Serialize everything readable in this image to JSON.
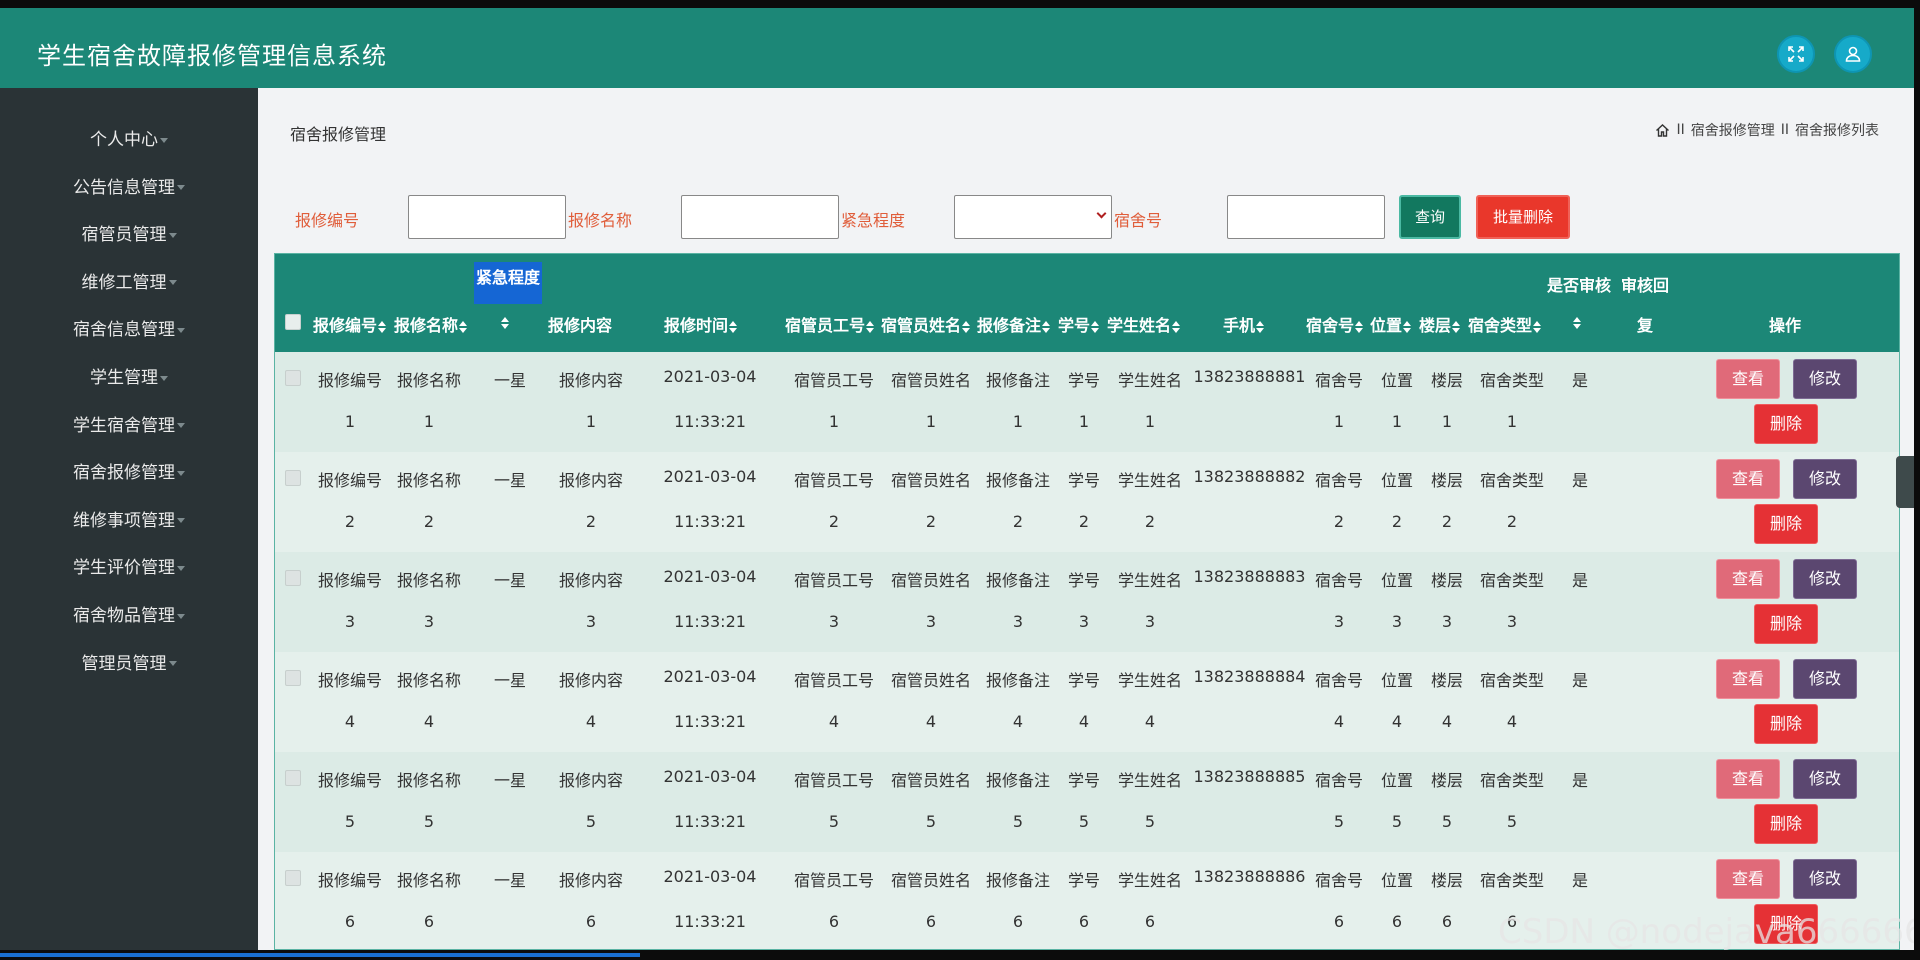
{
  "app": {
    "title": "学生宿舍故障报修管理信息系统"
  },
  "sidebar": {
    "items": [
      {
        "label": "个人中心"
      },
      {
        "label": "公告信息管理"
      },
      {
        "label": "宿管员管理"
      },
      {
        "label": "维修工管理"
      },
      {
        "label": "宿舍信息管理"
      },
      {
        "label": "学生管理"
      },
      {
        "label": "学生宿舍管理"
      },
      {
        "label": "宿舍报修管理"
      },
      {
        "label": "维修事项管理"
      },
      {
        "label": "学生评价管理"
      },
      {
        "label": "宿舍物品管理"
      },
      {
        "label": "管理员管理"
      }
    ]
  },
  "page": {
    "title": "宿舍报修管理",
    "breadcrumb": [
      "宿舍报修管理",
      "宿舍报修列表"
    ],
    "breadcrumb_sep": "II"
  },
  "filters": {
    "code_label": "报修编号",
    "name_label": "报修名称",
    "urgency_label": "紧急程度",
    "room_label": "宿舍号",
    "query_button": "查询",
    "batch_delete_button": "批量删除"
  },
  "table": {
    "header_top": {
      "urgency": "紧急程度",
      "approved": "是否审核",
      "reply": "审核回"
    },
    "headers": {
      "code": "报修编号",
      "name": "报修名称",
      "content": "报修内容",
      "time": "报修时间",
      "staff_no": "宿管员工号",
      "staff_name": "宿管员姓名",
      "note": "报修备注",
      "student_no": "学号",
      "student_name": "学生姓名",
      "phone": "手机",
      "room": "宿舍号",
      "location": "位置",
      "floor": "楼层",
      "room_type": "宿舍类型",
      "reply": "复",
      "actions": "操作"
    },
    "rows": [
      {
        "code": "报修编号",
        "code2": "1",
        "name": "报修名称",
        "name2": "1",
        "urgency": "一星",
        "content": "报修内容",
        "content2": "1",
        "date": "2021-03-04",
        "time": "11:33:21",
        "staff_no": "宿管员工号",
        "staff_no2": "1",
        "staff_name": "宿管员姓名",
        "staff_name2": "1",
        "note": "报修备注",
        "note2": "1",
        "student_no": "学号",
        "student_no2": "1",
        "student_name": "学生姓名",
        "student_name2": "1",
        "phone": "13823888881",
        "room": "宿舍号",
        "room2": "1",
        "location": "位置",
        "location2": "1",
        "floor": "楼层",
        "floor2": "1",
        "room_type": "宿舍类型",
        "room_type2": "1",
        "approved": "是"
      },
      {
        "code": "报修编号",
        "code2": "2",
        "name": "报修名称",
        "name2": "2",
        "urgency": "一星",
        "content": "报修内容",
        "content2": "2",
        "date": "2021-03-04",
        "time": "11:33:21",
        "staff_no": "宿管员工号",
        "staff_no2": "2",
        "staff_name": "宿管员姓名",
        "staff_name2": "2",
        "note": "报修备注",
        "note2": "2",
        "student_no": "学号",
        "student_no2": "2",
        "student_name": "学生姓名",
        "student_name2": "2",
        "phone": "13823888882",
        "room": "宿舍号",
        "room2": "2",
        "location": "位置",
        "location2": "2",
        "floor": "楼层",
        "floor2": "2",
        "room_type": "宿舍类型",
        "room_type2": "2",
        "approved": "是"
      },
      {
        "code": "报修编号",
        "code2": "3",
        "name": "报修名称",
        "name2": "3",
        "urgency": "一星",
        "content": "报修内容",
        "content2": "3",
        "date": "2021-03-04",
        "time": "11:33:21",
        "staff_no": "宿管员工号",
        "staff_no2": "3",
        "staff_name": "宿管员姓名",
        "staff_name2": "3",
        "note": "报修备注",
        "note2": "3",
        "student_no": "学号",
        "student_no2": "3",
        "student_name": "学生姓名",
        "student_name2": "3",
        "phone": "13823888883",
        "room": "宿舍号",
        "room2": "3",
        "location": "位置",
        "location2": "3",
        "floor": "楼层",
        "floor2": "3",
        "room_type": "宿舍类型",
        "room_type2": "3",
        "approved": "是"
      },
      {
        "code": "报修编号",
        "code2": "4",
        "name": "报修名称",
        "name2": "4",
        "urgency": "一星",
        "content": "报修内容",
        "content2": "4",
        "date": "2021-03-04",
        "time": "11:33:21",
        "staff_no": "宿管员工号",
        "staff_no2": "4",
        "staff_name": "宿管员姓名",
        "staff_name2": "4",
        "note": "报修备注",
        "note2": "4",
        "student_no": "学号",
        "student_no2": "4",
        "student_name": "学生姓名",
        "student_name2": "4",
        "phone": "13823888884",
        "room": "宿舍号",
        "room2": "4",
        "location": "位置",
        "location2": "4",
        "floor": "楼层",
        "floor2": "4",
        "room_type": "宿舍类型",
        "room_type2": "4",
        "approved": "是"
      },
      {
        "code": "报修编号",
        "code2": "5",
        "name": "报修名称",
        "name2": "5",
        "urgency": "一星",
        "content": "报修内容",
        "content2": "5",
        "date": "2021-03-04",
        "time": "11:33:21",
        "staff_no": "宿管员工号",
        "staff_no2": "5",
        "staff_name": "宿管员姓名",
        "staff_name2": "5",
        "note": "报修备注",
        "note2": "5",
        "student_no": "学号",
        "student_no2": "5",
        "student_name": "学生姓名",
        "student_name2": "5",
        "phone": "13823888885",
        "room": "宿舍号",
        "room2": "5",
        "location": "位置",
        "location2": "5",
        "floor": "楼层",
        "floor2": "5",
        "room_type": "宿舍类型",
        "room_type2": "5",
        "approved": "是"
      },
      {
        "code": "报修编号",
        "code2": "6",
        "name": "报修名称",
        "name2": "6",
        "urgency": "一星",
        "content": "报修内容",
        "content2": "6",
        "date": "2021-03-04",
        "time": "11:33:21",
        "staff_no": "宿管员工号",
        "staff_no2": "6",
        "staff_name": "宿管员姓名",
        "staff_name2": "6",
        "note": "报修备注",
        "note2": "6",
        "student_no": "学号",
        "student_no2": "6",
        "student_name": "学生姓名",
        "student_name2": "6",
        "phone": "13823888886",
        "room": "宿舍号",
        "room2": "6",
        "location": "位置",
        "location2": "6",
        "floor": "楼层",
        "floor2": "6",
        "room_type": "宿舍类型",
        "room_type2": "6",
        "approved": "是"
      }
    ],
    "row_actions": {
      "view": "查看",
      "edit": "修改",
      "delete": "删除"
    }
  },
  "watermark": "CSDN @nodejava666666",
  "colors": {
    "primary": "#1c8777",
    "sidebar": "#2a3336",
    "label": "#e05d3a",
    "view": "#e06a79",
    "edit": "#5b4770",
    "delete": "#e53135"
  },
  "icons": {
    "fullscreen": "expand-icon",
    "user": "user-icon",
    "home": "home-icon"
  }
}
